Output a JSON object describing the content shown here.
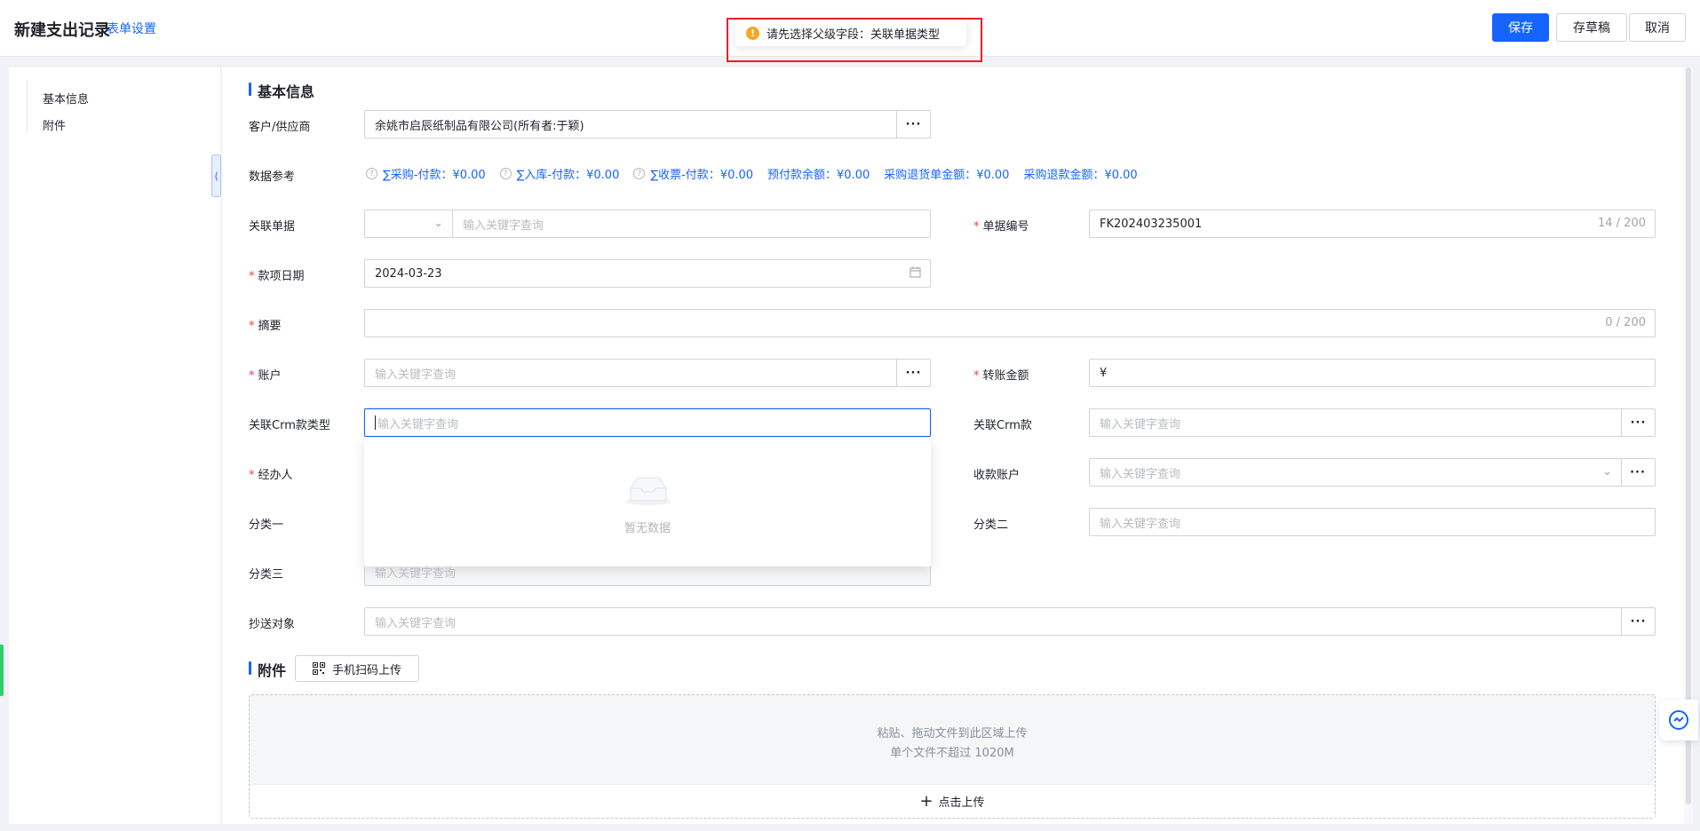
{
  "header": {
    "title": "新建支出记录",
    "form_settings": "表单设置",
    "save_label": "保存",
    "draft_label": "存草稿",
    "cancel_label": "取消"
  },
  "toast": {
    "message": "请先选择父级字段：关联单据类型",
    "icon": "warning-icon"
  },
  "sidebar": {
    "items": [
      {
        "label": "基本信息"
      },
      {
        "label": "附件"
      }
    ]
  },
  "sections": {
    "basic": "基本信息",
    "attachments": "附件"
  },
  "fields": {
    "customer": {
      "label": "客户/供应商",
      "value": "余姚市启辰纸制品有限公司(所有者:于颖)"
    },
    "data_ref": {
      "label": "数据参考",
      "items": [
        {
          "text": "∑采购-付款：¥0.00",
          "has_help": true
        },
        {
          "text": "∑入库-付款：¥0.00",
          "has_help": true
        },
        {
          "text": "∑收票-付款：¥0.00",
          "has_help": true
        },
        {
          "text": "预付款余额：¥0.00",
          "has_help": false
        },
        {
          "text": "采购退货单金额：¥0.00",
          "has_help": false
        },
        {
          "text": "采购退款金额：¥0.00",
          "has_help": false
        }
      ]
    },
    "related_doc": {
      "label": "关联单据",
      "placeholder": "输入关键字查询"
    },
    "doc_no": {
      "label": "单据编号",
      "value": "FK202403235001",
      "counter": "14 / 200"
    },
    "date": {
      "label": "款项日期",
      "value": "2024-03-23"
    },
    "summary": {
      "label": "摘要",
      "counter": "0 / 200"
    },
    "account": {
      "label": "账户",
      "placeholder": "输入关键字查询"
    },
    "amount": {
      "label": "转账金额",
      "prefix": "¥"
    },
    "crm_type": {
      "label": "关联Crm款类型",
      "placeholder": "输入关键字查询"
    },
    "crm": {
      "label": "关联Crm款",
      "placeholder": "输入关键字查询"
    },
    "handler": {
      "label": "经办人"
    },
    "receive_account": {
      "label": "收款账户",
      "placeholder": "输入关键字查询"
    },
    "cat1": {
      "label": "分类一"
    },
    "cat2": {
      "label": "分类二",
      "placeholder": "输入关键字查询"
    },
    "cat3": {
      "label": "分类三",
      "placeholder": "输入关键字查询"
    },
    "cc": {
      "label": "抄送对象",
      "placeholder": "输入关键字查询"
    }
  },
  "dropdown": {
    "empty_text": "暂无数据"
  },
  "attachments": {
    "scan_upload": "手机扫码上传",
    "hint_line1": "粘贴、拖动文件到此区域上传",
    "hint_line2": "单个文件不超过 1020M",
    "upload_button": "点击上传"
  },
  "colors": {
    "primary": "#1664ff",
    "required": "#f53f3f",
    "warning": "#f5a623",
    "highlight_box": "#e8202a"
  }
}
